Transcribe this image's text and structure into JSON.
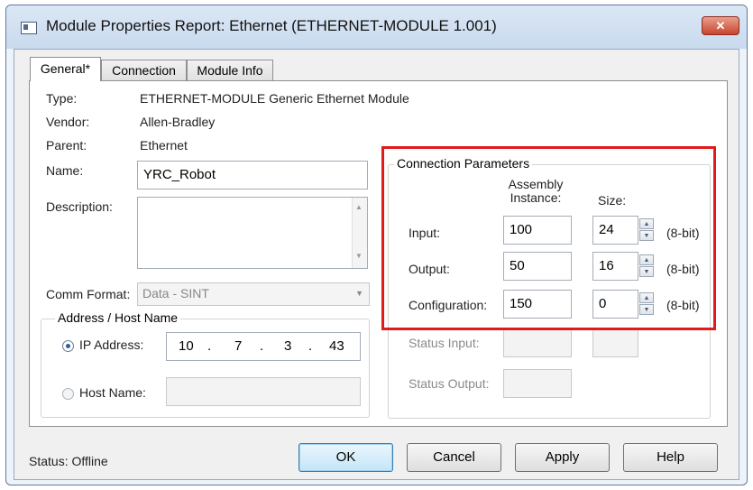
{
  "window": {
    "title": "Module Properties Report: Ethernet (ETHERNET-MODULE 1.001)",
    "close_label": "✕"
  },
  "tabs": [
    {
      "label": "General*"
    },
    {
      "label": "Connection"
    },
    {
      "label": "Module Info"
    }
  ],
  "general": {
    "type_label": "Type:",
    "type_value": "ETHERNET-MODULE Generic Ethernet Module",
    "vendor_label": "Vendor:",
    "vendor_value": "Allen-Bradley",
    "parent_label": "Parent:",
    "parent_value": "Ethernet",
    "name_label": "Name:",
    "name_value": "YRC_Robot",
    "description_label": "Description:",
    "description_value": "",
    "comm_format_label": "Comm Format:",
    "comm_format_value": "Data - SINT"
  },
  "address": {
    "group_title": "Address / Host Name",
    "ip_label": "IP Address:",
    "ip_octets": [
      "10",
      "7",
      "3",
      "43"
    ],
    "ip_selected": true,
    "host_label": "Host Name:",
    "host_value": ""
  },
  "connection_params": {
    "title": "Connection Parameters",
    "col_assembly_line1": "Assembly",
    "col_assembly_line2": "Instance:",
    "col_size": "Size:",
    "rows": [
      {
        "label": "Input:",
        "instance": "100",
        "size": "24",
        "unit": "(8-bit)"
      },
      {
        "label": "Output:",
        "instance": "50",
        "size": "16",
        "unit": "(8-bit)"
      },
      {
        "label": "Configuration:",
        "instance": "150",
        "size": "0",
        "unit": "(8-bit)"
      }
    ],
    "status_input_label": "Status Input:",
    "status_output_label": "Status Output:"
  },
  "footer": {
    "status_text": "Status:  Offline",
    "ok_label": "OK",
    "cancel_label": "Cancel",
    "apply_label": "Apply",
    "help_label": "Help"
  },
  "colors": {
    "highlight_border": "#e01b1b",
    "default_button": "#3d7bad"
  }
}
